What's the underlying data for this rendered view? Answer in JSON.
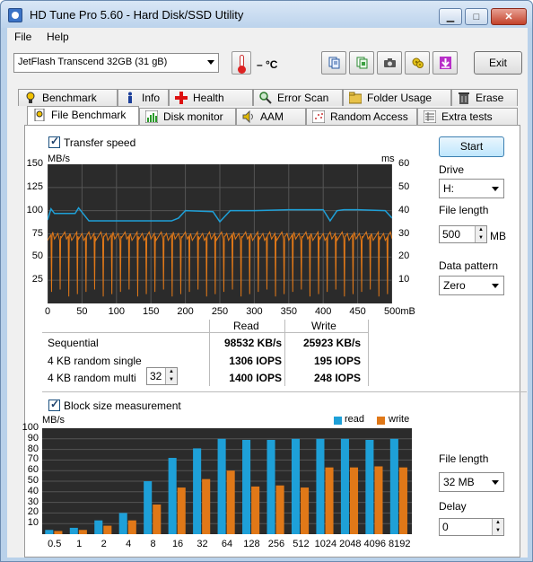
{
  "window": {
    "title": "HD Tune Pro 5.60 - Hard Disk/SSD Utility"
  },
  "menu": {
    "file": "File",
    "help": "Help"
  },
  "toolbar": {
    "drive": "JetFlash Transcend 32GB (31 gB)",
    "temperature": "– °C",
    "exit_label": "Exit",
    "icons": [
      "copy-info-icon",
      "copy-screen-icon",
      "screenshot-camera-icon",
      "options-icon",
      "save-download-icon"
    ]
  },
  "tabs_top": [
    "Benchmark",
    "Info",
    "Health",
    "Error Scan",
    "Folder Usage",
    "Erase"
  ],
  "tabs_bottom": [
    "File Benchmark",
    "Disk monitor",
    "AAM",
    "Random Access",
    "Extra tests"
  ],
  "transfer": {
    "checkbox_label": "Transfer speed",
    "left_unit": "MB/s",
    "right_unit": "ms",
    "left_ticks": [
      "150",
      "125",
      "100",
      "75",
      "50",
      "25"
    ],
    "right_ticks": [
      "60",
      "50",
      "40",
      "30",
      "20",
      "10"
    ],
    "x_ticks": [
      "0",
      "50",
      "100",
      "150",
      "200",
      "250",
      "300",
      "350",
      "400",
      "450",
      "500mB"
    ]
  },
  "results": {
    "col_read": "Read",
    "col_write": "Write",
    "rows": [
      {
        "label": "Sequential",
        "read": "98532 KB/s",
        "write": "25923 KB/s"
      },
      {
        "label": "4 KB random single",
        "read": "1306 IOPS",
        "write": "195 IOPS"
      },
      {
        "label": "4 KB random multi",
        "read": "1400 IOPS",
        "write": "248 IOPS"
      }
    ],
    "queue_depth": "32"
  },
  "side": {
    "start_label": "Start",
    "drive_label": "Drive",
    "drive_value": "H:",
    "file_length_label": "File length",
    "file_length_value": "500",
    "file_length_unit": "MB",
    "pattern_label": "Data pattern",
    "pattern_value": "Zero",
    "block_file_length_label": "File length",
    "block_file_length_value": "32 MB",
    "delay_label": "Delay",
    "delay_value": "0"
  },
  "colors": {
    "read": "#1ea0d8",
    "write": "#e07818",
    "graph_bg": "#2b2b2b",
    "grid": "#555555"
  },
  "chart_data": [
    {
      "type": "line",
      "title": "Transfer speed",
      "xlabel": "mB",
      "ylabel": "MB/s",
      "y2label": "ms",
      "xlim": [
        0,
        500
      ],
      "ylim": [
        0,
        150
      ],
      "y2lim": [
        0,
        60
      ],
      "series": [
        {
          "name": "transfer rate",
          "x": [
            0,
            5,
            10,
            40,
            45,
            60,
            100,
            150,
            180,
            190,
            200,
            240,
            250,
            265,
            300,
            350,
            400,
            410,
            420,
            430,
            440,
            450,
            490,
            500
          ],
          "values": [
            90,
            102,
            97,
            97,
            103,
            89,
            89,
            89,
            89,
            92,
            100,
            99,
            88,
            100,
            100,
            101,
            101,
            89,
            100,
            101,
            101,
            101,
            100,
            92
          ]
        },
        {
          "name": "access time",
          "x": [
            0,
            50,
            100,
            150,
            200,
            250,
            300,
            350,
            400,
            450,
            500
          ],
          "values": [
            29,
            29,
            29,
            29,
            29,
            29,
            29,
            29,
            29,
            29,
            29
          ]
        }
      ]
    },
    {
      "type": "bar",
      "title": "Block size measurement",
      "ylabel": "MB/s",
      "ylim": [
        0,
        100
      ],
      "categories": [
        "0.5",
        "1",
        "2",
        "4",
        "8",
        "16",
        "32",
        "64",
        "128",
        "256",
        "512",
        "1024",
        "2048",
        "4096",
        "8192"
      ],
      "series": [
        {
          "name": "read",
          "values": [
            4,
            6,
            13,
            20,
            50,
            72,
            81,
            90,
            89,
            89,
            90,
            90,
            90,
            89,
            90
          ]
        },
        {
          "name": "write",
          "values": [
            3,
            4,
            8,
            13,
            28,
            44,
            52,
            60,
            45,
            46,
            44,
            63,
            63,
            64,
            63
          ]
        }
      ]
    }
  ],
  "block": {
    "checkbox_label": "Block size measurement",
    "unit": "MB/s",
    "legend_read": "read",
    "legend_write": "write",
    "y_ticks": [
      "100",
      "90",
      "80",
      "70",
      "60",
      "50",
      "40",
      "30",
      "20",
      "10"
    ]
  }
}
